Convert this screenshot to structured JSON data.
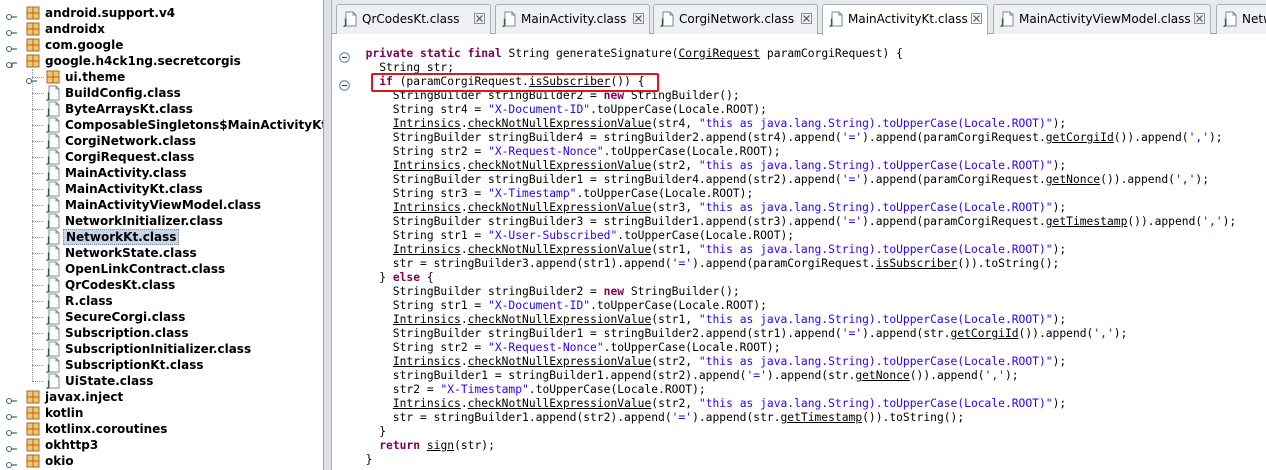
{
  "tree": {
    "items": [
      {
        "label": "android.support.v4",
        "type": "package",
        "level": 0,
        "expanded": false
      },
      {
        "label": "androidx",
        "type": "package",
        "level": 0,
        "expanded": false
      },
      {
        "label": "com.google",
        "type": "package",
        "level": 0,
        "expanded": false
      },
      {
        "label": "google.h4ck1ng.secretcorgis",
        "type": "package",
        "level": 0,
        "expanded": true
      },
      {
        "label": "ui.theme",
        "type": "package",
        "level": 1,
        "expanded": false
      },
      {
        "label": "BuildConfig.class",
        "type": "class",
        "level": 1
      },
      {
        "label": "ByteArraysKt.class",
        "type": "class",
        "level": 1
      },
      {
        "label": "ComposableSingletons$MainActivityKt.class",
        "type": "class",
        "level": 1
      },
      {
        "label": "CorgiNetwork.class",
        "type": "class",
        "level": 1
      },
      {
        "label": "CorgiRequest.class",
        "type": "class",
        "level": 1
      },
      {
        "label": "MainActivity.class",
        "type": "class",
        "level": 1
      },
      {
        "label": "MainActivityKt.class",
        "type": "class",
        "level": 1
      },
      {
        "label": "MainActivityViewModel.class",
        "type": "class",
        "level": 1
      },
      {
        "label": "NetworkInitializer.class",
        "type": "class",
        "level": 1
      },
      {
        "label": "NetworkKt.class",
        "type": "class",
        "level": 1,
        "selected": true
      },
      {
        "label": "NetworkState.class",
        "type": "class",
        "level": 1
      },
      {
        "label": "OpenLinkContract.class",
        "type": "class",
        "level": 1
      },
      {
        "label": "QrCodesKt.class",
        "type": "class",
        "level": 1
      },
      {
        "label": "R.class",
        "type": "class",
        "level": 1
      },
      {
        "label": "SecureCorgi.class",
        "type": "class",
        "level": 1
      },
      {
        "label": "Subscription.class",
        "type": "class",
        "level": 1
      },
      {
        "label": "SubscriptionInitializer.class",
        "type": "class",
        "level": 1
      },
      {
        "label": "SubscriptionKt.class",
        "type": "class",
        "level": 1
      },
      {
        "label": "UiState.class",
        "type": "class",
        "level": 1
      },
      {
        "label": "javax.inject",
        "type": "package",
        "level": 0,
        "expanded": false
      },
      {
        "label": "kotlin",
        "type": "package",
        "level": 0,
        "expanded": false
      },
      {
        "label": "kotlinx.coroutines",
        "type": "package",
        "level": 0,
        "expanded": false
      },
      {
        "label": "okhttp3",
        "type": "package",
        "level": 0,
        "expanded": false
      },
      {
        "label": "okio",
        "type": "package",
        "level": 0,
        "expanded": false
      }
    ]
  },
  "tabs": [
    {
      "label": "QrCodesKt.class",
      "active": false
    },
    {
      "label": "MainActivity.class",
      "active": false
    },
    {
      "label": "CorgiNetwork.class",
      "active": false
    },
    {
      "label": "MainActivityKt.class",
      "active": true
    },
    {
      "label": "MainActivityViewModel.class",
      "active": false
    },
    {
      "label": "Netw",
      "active": false
    }
  ],
  "code": {
    "lines": [
      [
        [
          "",
          "  "
        ],
        [
          "kw",
          "private static final"
        ],
        [
          "",
          " String generateSignature("
        ],
        [
          "ul",
          "CorgiRequest"
        ],
        [
          "",
          " paramCorgiRequest) {"
        ]
      ],
      [
        [
          "",
          "    String str;"
        ]
      ],
      [
        [
          "",
          "    "
        ],
        [
          "kw",
          "if"
        ],
        [
          "",
          " (paramCorgiRequest."
        ],
        [
          "ul",
          "isSubscriber"
        ],
        [
          "",
          "()) {"
        ]
      ],
      [
        [
          "",
          "      StringBuilder stringBuilder2 = "
        ],
        [
          "kw",
          "new"
        ],
        [
          "",
          " StringBuilder();"
        ]
      ],
      [
        [
          "",
          "      String str4 = "
        ],
        [
          "str",
          "\"X-Document-ID\""
        ],
        [
          "",
          ".toUpperCase(Locale.ROOT);"
        ]
      ],
      [
        [
          "",
          "      "
        ],
        [
          "ul",
          "Intrinsics"
        ],
        [
          "",
          "."
        ],
        [
          "ul",
          "checkNotNullExpressionValue"
        ],
        [
          "",
          "(str4, "
        ],
        [
          "str",
          "\"this as java.lang.String).toUpperCase(Locale.ROOT)\""
        ],
        [
          "",
          ");"
        ]
      ],
      [
        [
          "",
          "      StringBuilder stringBuilder4 = stringBuilder2.append(str4).append("
        ],
        [
          "str",
          "'='"
        ],
        [
          "",
          ").append(paramCorgiRequest."
        ],
        [
          "ul",
          "getCorgiId"
        ],
        [
          "",
          "()).append("
        ],
        [
          "str",
          "','"
        ],
        [
          "",
          ");"
        ]
      ],
      [
        [
          "",
          "      String str2 = "
        ],
        [
          "str",
          "\"X-Request-Nonce\""
        ],
        [
          "",
          ".toUpperCase(Locale.ROOT);"
        ]
      ],
      [
        [
          "",
          "      "
        ],
        [
          "ul",
          "Intrinsics"
        ],
        [
          "",
          "."
        ],
        [
          "ul",
          "checkNotNullExpressionValue"
        ],
        [
          "",
          "(str2, "
        ],
        [
          "str",
          "\"this as java.lang.String).toUpperCase(Locale.ROOT)\""
        ],
        [
          "",
          ");"
        ]
      ],
      [
        [
          "",
          "      StringBuilder stringBuilder1 = stringBuilder4.append(str2).append("
        ],
        [
          "str",
          "'='"
        ],
        [
          "",
          ").append(paramCorgiRequest."
        ],
        [
          "ul",
          "getNonce"
        ],
        [
          "",
          "()).append("
        ],
        [
          "str",
          "','"
        ],
        [
          "",
          ");"
        ]
      ],
      [
        [
          "",
          "      String str3 = "
        ],
        [
          "str",
          "\"X-Timestamp\""
        ],
        [
          "",
          ".toUpperCase(Locale.ROOT);"
        ]
      ],
      [
        [
          "",
          "      "
        ],
        [
          "ul",
          "Intrinsics"
        ],
        [
          "",
          "."
        ],
        [
          "ul",
          "checkNotNullExpressionValue"
        ],
        [
          "",
          "(str3, "
        ],
        [
          "str",
          "\"this as java.lang.String).toUpperCase(Locale.ROOT)\""
        ],
        [
          "",
          ");"
        ]
      ],
      [
        [
          "",
          "      StringBuilder stringBuilder3 = stringBuilder1.append(str3).append("
        ],
        [
          "str",
          "'='"
        ],
        [
          "",
          ").append(paramCorgiRequest."
        ],
        [
          "ul",
          "getTimestamp"
        ],
        [
          "",
          "()).append("
        ],
        [
          "str",
          "','"
        ],
        [
          "",
          ");"
        ]
      ],
      [
        [
          "",
          "      String str1 = "
        ],
        [
          "str",
          "\"X-User-Subscribed\""
        ],
        [
          "",
          ".toUpperCase(Locale.ROOT);"
        ]
      ],
      [
        [
          "",
          "      "
        ],
        [
          "ul",
          "Intrinsics"
        ],
        [
          "",
          "."
        ],
        [
          "ul",
          "checkNotNullExpressionValue"
        ],
        [
          "",
          "(str1, "
        ],
        [
          "str",
          "\"this as java.lang.String).toUpperCase(Locale.ROOT)\""
        ],
        [
          "",
          ");"
        ]
      ],
      [
        [
          "",
          "      str = stringBuilder3.append(str1).append("
        ],
        [
          "str",
          "'='"
        ],
        [
          "",
          ").append(paramCorgiRequest."
        ],
        [
          "ul",
          "isSubscriber"
        ],
        [
          "",
          "()).toString();"
        ]
      ],
      [
        [
          "",
          "    } "
        ],
        [
          "kw",
          "else"
        ],
        [
          "",
          " {"
        ]
      ],
      [
        [
          "",
          "      StringBuilder stringBuilder2 = "
        ],
        [
          "kw",
          "new"
        ],
        [
          "",
          " StringBuilder();"
        ]
      ],
      [
        [
          "",
          "      String str1 = "
        ],
        [
          "str",
          "\"X-Document-ID\""
        ],
        [
          "",
          ".toUpperCase(Locale.ROOT);"
        ]
      ],
      [
        [
          "",
          "      "
        ],
        [
          "ul",
          "Intrinsics"
        ],
        [
          "",
          "."
        ],
        [
          "ul",
          "checkNotNullExpressionValue"
        ],
        [
          "",
          "(str1, "
        ],
        [
          "str",
          "\"this as java.lang.String).toUpperCase(Locale.ROOT)\""
        ],
        [
          "",
          ");"
        ]
      ],
      [
        [
          "",
          "      StringBuilder stringBuilder1 = stringBuilder2.append(str1).append("
        ],
        [
          "str",
          "'='"
        ],
        [
          "",
          ").append(str."
        ],
        [
          "ul",
          "getCorgiId"
        ],
        [
          "",
          "()).append("
        ],
        [
          "str",
          "','"
        ],
        [
          "",
          ");"
        ]
      ],
      [
        [
          "",
          "      String str2 = "
        ],
        [
          "str",
          "\"X-Request-Nonce\""
        ],
        [
          "",
          ".toUpperCase(Locale.ROOT);"
        ]
      ],
      [
        [
          "",
          "      "
        ],
        [
          "ul",
          "Intrinsics"
        ],
        [
          "",
          "."
        ],
        [
          "ul",
          "checkNotNullExpressionValue"
        ],
        [
          "",
          "(str2, "
        ],
        [
          "str",
          "\"this as java.lang.String).toUpperCase(Locale.ROOT)\""
        ],
        [
          "",
          ");"
        ]
      ],
      [
        [
          "",
          "      stringBuilder1 = stringBuilder1.append(str2).append("
        ],
        [
          "str",
          "'='"
        ],
        [
          "",
          ").append(str."
        ],
        [
          "ul",
          "getNonce"
        ],
        [
          "",
          "()).append("
        ],
        [
          "str",
          "','"
        ],
        [
          "",
          ");"
        ]
      ],
      [
        [
          "",
          "      str2 = "
        ],
        [
          "str",
          "\"X-Timestamp\""
        ],
        [
          "",
          ".toUpperCase(Locale.ROOT);"
        ]
      ],
      [
        [
          "",
          "      "
        ],
        [
          "ul",
          "Intrinsics"
        ],
        [
          "",
          "."
        ],
        [
          "ul",
          "checkNotNullExpressionValue"
        ],
        [
          "",
          "(str2, "
        ],
        [
          "str",
          "\"this as java.lang.String).toUpperCase(Locale.ROOT)\""
        ],
        [
          "",
          ");"
        ]
      ],
      [
        [
          "",
          "      str = stringBuilder1.append(str2).append("
        ],
        [
          "str",
          "'='"
        ],
        [
          "",
          ").append(str."
        ],
        [
          "ul",
          "getTimestamp"
        ],
        [
          "",
          "()).toString();"
        ]
      ],
      [
        [
          "",
          "    }"
        ]
      ],
      [
        [
          "",
          "    "
        ],
        [
          "kw",
          "return"
        ],
        [
          "",
          " "
        ],
        [
          "ul",
          "sign"
        ],
        [
          "",
          "(str);"
        ]
      ],
      [
        [
          "",
          "  }"
        ]
      ]
    ]
  },
  "colors": {
    "keyword": "#7f0055",
    "string": "#2a00ff",
    "highlight_box": "#e2141b",
    "selection": "#c5d4e8",
    "package_icon": "#c98a2e",
    "class_icon": "#3a7a3a"
  },
  "icons": {
    "package": "package-icon",
    "class": "class-file-icon",
    "collapse": "collapse-icon",
    "close": "close-icon"
  }
}
